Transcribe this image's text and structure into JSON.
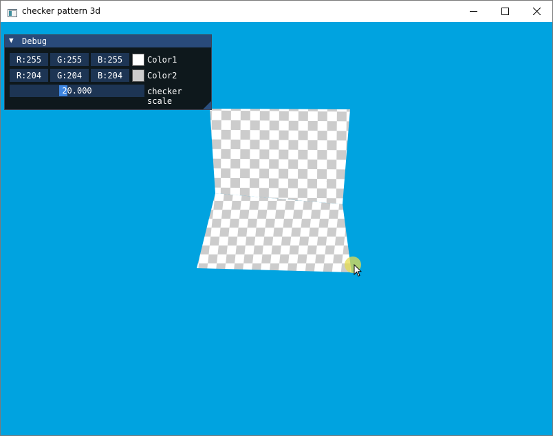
{
  "window": {
    "title": "checker pattern 3d",
    "icon": "app-window-icon",
    "controls": {
      "minimize": "minimize-icon",
      "maximize": "maximize-icon",
      "close": "close-icon"
    }
  },
  "colors": {
    "background": "#00a3e0",
    "checker_light": "#ffffff",
    "checker_dark": "#cccccc",
    "panel_title": "#294a7a",
    "field": "#1d3554"
  },
  "debug": {
    "title": "Debug",
    "collapse_icon": "collapse-triangle-icon",
    "color1": {
      "r": "R:255",
      "g": "G:255",
      "b": "B:255",
      "swatch": "#ffffff",
      "label": "Color1"
    },
    "color2": {
      "r": "R:204",
      "g": "G:204",
      "b": "B:204",
      "swatch": "#cccccc",
      "label": "Color2"
    },
    "scale": {
      "value": "20.000",
      "label": "checker scale"
    }
  }
}
